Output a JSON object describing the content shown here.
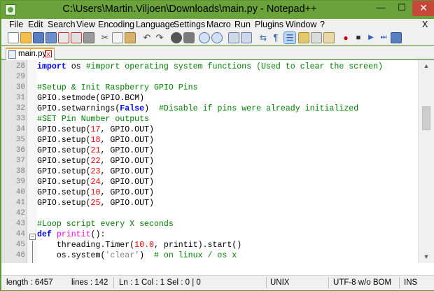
{
  "window": {
    "title": "C:\\Users\\Martin.Viljoen\\Downloads\\main.py - Notepad++",
    "minimize": "—",
    "maximize": "☐",
    "close": "✕"
  },
  "menu": {
    "items": [
      "File",
      "Edit",
      "Search",
      "View",
      "Encoding",
      "Language",
      "Settings",
      "Macro",
      "Run",
      "Plugins",
      "Window",
      "?"
    ],
    "close_doc": "X"
  },
  "toolbar": {
    "icons": [
      "new-file-icon",
      "open-file-icon",
      "save-icon",
      "save-all-icon",
      "close-icon",
      "close-all-icon",
      "print-icon",
      "cut-icon",
      "copy-icon",
      "paste-icon",
      "undo-icon",
      "redo-icon",
      "find-icon",
      "replace-icon",
      "zoom-in-icon",
      "zoom-out-icon",
      "sync-vertical-icon",
      "sync-horizontal-icon",
      "word-wrap-icon",
      "show-all-characters-icon",
      "indent-guide-icon",
      "user-defined-language-icon",
      "document-map-icon",
      "function-list-icon",
      "record-macro-icon",
      "stop-recording-icon",
      "play-macro-icon",
      "run-macro-multiple-icon",
      "save-macro-icon"
    ]
  },
  "tab": {
    "label": "main.py",
    "close": "x"
  },
  "editor": {
    "lines": [
      {
        "n": "28",
        "code": [
          {
            "t": "import",
            "c": "kw"
          },
          {
            "t": " os ",
            "c": ""
          },
          {
            "t": "#import operating system functions (Used to clear the screen)",
            "c": "cm"
          }
        ]
      },
      {
        "n": "29",
        "code": []
      },
      {
        "n": "30",
        "code": [
          {
            "t": "#Setup & Init Raspberry GPIO Pins",
            "c": "cm"
          }
        ]
      },
      {
        "n": "31",
        "code": [
          {
            "t": "GPIO.setmode(GPIO.BCM)",
            "c": ""
          }
        ]
      },
      {
        "n": "32",
        "code": [
          {
            "t": "GPIO.setwarnings(",
            "c": ""
          },
          {
            "t": "False",
            "c": "blue"
          },
          {
            "t": ")  ",
            "c": ""
          },
          {
            "t": "#Disable if pins were already initialized",
            "c": "cm"
          }
        ]
      },
      {
        "n": "33",
        "code": [
          {
            "t": "#SET Pin Number outputs",
            "c": "cm"
          }
        ]
      },
      {
        "n": "34",
        "code": [
          {
            "t": "GPIO.setup(",
            "c": ""
          },
          {
            "t": "17",
            "c": "num"
          },
          {
            "t": ", GPIO.OUT)",
            "c": ""
          }
        ]
      },
      {
        "n": "35",
        "code": [
          {
            "t": "GPIO.setup(",
            "c": ""
          },
          {
            "t": "18",
            "c": "num"
          },
          {
            "t": ", GPIO.OUT)",
            "c": ""
          }
        ]
      },
      {
        "n": "36",
        "code": [
          {
            "t": "GPIO.setup(",
            "c": ""
          },
          {
            "t": "21",
            "c": "num"
          },
          {
            "t": ", GPIO.OUT)",
            "c": ""
          }
        ]
      },
      {
        "n": "37",
        "code": [
          {
            "t": "GPIO.setup(",
            "c": ""
          },
          {
            "t": "22",
            "c": "num"
          },
          {
            "t": ", GPIO.OUT)",
            "c": ""
          }
        ]
      },
      {
        "n": "38",
        "code": [
          {
            "t": "GPIO.setup(",
            "c": ""
          },
          {
            "t": "23",
            "c": "num"
          },
          {
            "t": ", GPIO.OUT)",
            "c": ""
          }
        ]
      },
      {
        "n": "39",
        "code": [
          {
            "t": "GPIO.setup(",
            "c": ""
          },
          {
            "t": "24",
            "c": "num"
          },
          {
            "t": ", GPIO.OUT)",
            "c": ""
          }
        ]
      },
      {
        "n": "40",
        "code": [
          {
            "t": "GPIO.setup(",
            "c": ""
          },
          {
            "t": "10",
            "c": "num"
          },
          {
            "t": ", GPIO.OUT)",
            "c": ""
          }
        ]
      },
      {
        "n": "41",
        "code": [
          {
            "t": "GPIO.setup(",
            "c": ""
          },
          {
            "t": "25",
            "c": "num"
          },
          {
            "t": ", GPIO.OUT)",
            "c": ""
          }
        ]
      },
      {
        "n": "42",
        "code": []
      },
      {
        "n": "43",
        "code": [
          {
            "t": "#Loop script every X seconds",
            "c": "cm"
          }
        ]
      },
      {
        "n": "44",
        "code": [
          {
            "t": "def",
            "c": "kw"
          },
          {
            "t": " ",
            "c": ""
          },
          {
            "t": "printit",
            "c": "fn"
          },
          {
            "t": "():",
            "c": ""
          }
        ]
      },
      {
        "n": "45",
        "code": [
          {
            "t": "    threading.Timer(",
            "c": ""
          },
          {
            "t": "10.0",
            "c": "num"
          },
          {
            "t": ", printit).start()",
            "c": ""
          }
        ]
      },
      {
        "n": "46",
        "code": [
          {
            "t": "    os.system(",
            "c": ""
          },
          {
            "t": "'clear'",
            "c": "str"
          },
          {
            "t": ")  ",
            "c": ""
          },
          {
            "t": "# on linux / os x",
            "c": "cm"
          }
        ]
      }
    ]
  },
  "status": {
    "length": "length : 6457",
    "lines": "lines : 142",
    "position": "Ln : 1    Col : 1    Sel : 0 | 0",
    "eol": "UNIX",
    "encoding": "UTF-8 w/o BOM",
    "mode": "INS"
  },
  "colors": {
    "titlebar": "#6aa33a",
    "keyword": "#0000ff",
    "comment": "#008000",
    "number": "#ff0000",
    "string": "#808080",
    "function": "#ff00ff",
    "tab_accent": "#f5a623"
  }
}
